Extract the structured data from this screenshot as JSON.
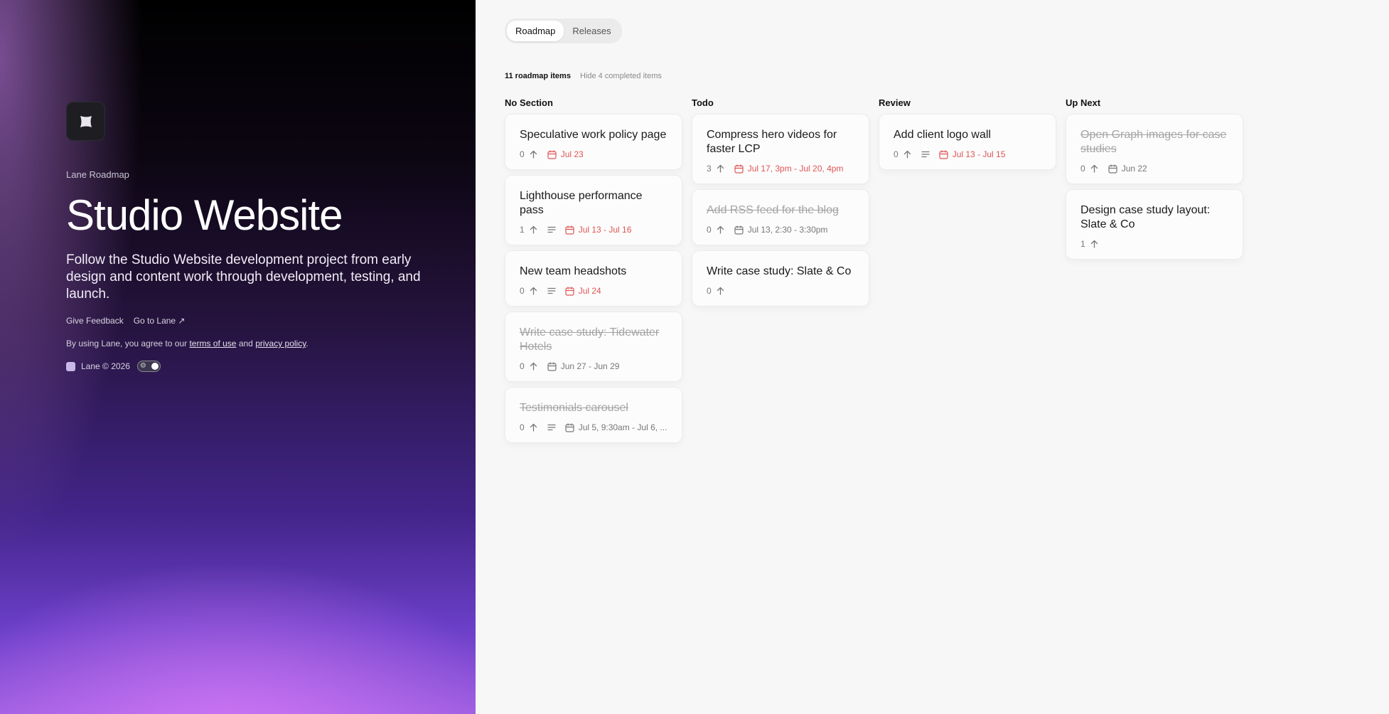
{
  "hero": {
    "eyebrow": "Lane Roadmap",
    "title": "Studio Website",
    "description": "Follow the Studio Website development project from early design and content work through development, testing, and launch.",
    "links": {
      "feedback": "Give Feedback",
      "go_to_lane": "Go to Lane ↗"
    },
    "legal": {
      "prefix": "By using Lane, you agree to our ",
      "terms": "terms of use",
      "and": " and ",
      "privacy": "privacy policy",
      "suffix": "."
    },
    "footer": "Lane © 2026"
  },
  "tabs": [
    {
      "label": "Roadmap",
      "active": true
    },
    {
      "label": "Releases",
      "active": false
    }
  ],
  "summary": {
    "count": "11 roadmap items",
    "hide": "Hide 4 completed items"
  },
  "colors": {
    "overdue": "#e05555",
    "muted": "#777777"
  },
  "columns": [
    {
      "title": "No Section",
      "cards": [
        {
          "title": "Speculative work policy page",
          "votes": "0",
          "has_description": false,
          "date": "Jul 23",
          "overdue": true,
          "done": false
        },
        {
          "title": "Lighthouse performance pass",
          "votes": "1",
          "has_description": true,
          "date": "Jul 13 - Jul 16",
          "overdue": true,
          "done": false
        },
        {
          "title": "New team headshots",
          "votes": "0",
          "has_description": true,
          "date": "Jul 24",
          "overdue": true,
          "done": false
        },
        {
          "title": "Write case study: Tidewater Hotels",
          "votes": "0",
          "has_description": false,
          "date": "Jun 27 - Jun 29",
          "overdue": false,
          "done": true
        },
        {
          "title": "Testimonials carousel",
          "votes": "0",
          "has_description": true,
          "date": "Jul 5, 9:30am - Jul 6, ...",
          "overdue": false,
          "done": true
        }
      ]
    },
    {
      "title": "Todo",
      "cards": [
        {
          "title": "Compress hero videos for faster LCP",
          "votes": "3",
          "has_description": false,
          "date": "Jul 17, 3pm - Jul 20, 4pm",
          "overdue": true,
          "done": false
        },
        {
          "title": "Add RSS feed for the blog",
          "votes": "0",
          "has_description": false,
          "date": "Jul 13, 2:30 - 3:30pm",
          "overdue": false,
          "done": true
        },
        {
          "title": "Write case study: Slate & Co",
          "votes": "0",
          "has_description": false,
          "date": "",
          "overdue": false,
          "done": false
        }
      ]
    },
    {
      "title": "Review",
      "cards": [
        {
          "title": "Add client logo wall",
          "votes": "0",
          "has_description": true,
          "date": "Jul 13 - Jul 15",
          "overdue": true,
          "done": false
        }
      ]
    },
    {
      "title": "Up Next",
      "cards": [
        {
          "title": "Open Graph images for case studies",
          "votes": "0",
          "has_description": false,
          "date": "Jun 22",
          "overdue": false,
          "done": true
        },
        {
          "title": "Design case study layout: Slate & Co",
          "votes": "1",
          "has_description": false,
          "date": "",
          "overdue": false,
          "done": false
        }
      ]
    }
  ]
}
